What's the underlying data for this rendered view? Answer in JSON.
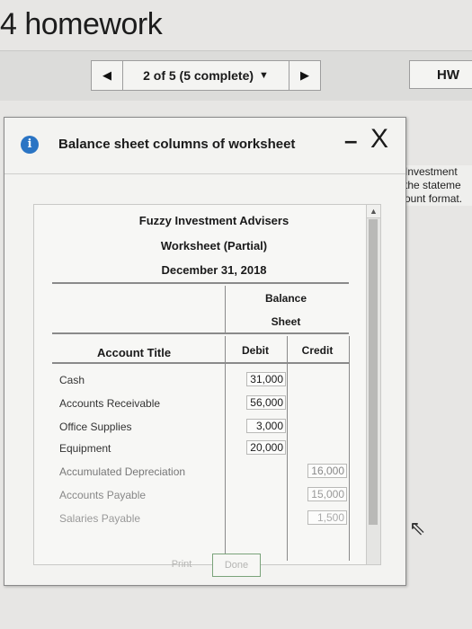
{
  "app": {
    "title": "4 homework"
  },
  "pager": {
    "prev_icon": "◀",
    "status": "2 of 5 (5 complete)",
    "dropdown_icon": "▼",
    "next_icon": "▶"
  },
  "hw_label": "HW",
  "side_text": {
    "line1": "Investment",
    "line2": "the stateme",
    "line3": "ount format."
  },
  "modal": {
    "info_icon": "i",
    "title": "Balance sheet columns of worksheet",
    "minimize_label": "–",
    "close_label": "X"
  },
  "worksheet": {
    "company": "Fuzzy Investment Advisers",
    "subtitle": "Worksheet (Partial)",
    "date": "December 31, 2018",
    "group_header_1": "Balance",
    "group_header_2": "Sheet",
    "col_account": "Account Title",
    "col_debit": "Debit",
    "col_credit": "Credit",
    "rows": [
      {
        "name": "Cash",
        "debit": "31,000",
        "credit": ""
      },
      {
        "name": "Accounts Receivable",
        "debit": "56,000",
        "credit": ""
      },
      {
        "name": "Office Supplies",
        "debit": "3,000",
        "credit": ""
      },
      {
        "name": "Equipment",
        "debit": "20,000",
        "credit": ""
      },
      {
        "name": "Accumulated Depreciation",
        "debit": "",
        "credit": "16,000"
      },
      {
        "name": "Accounts Payable",
        "debit": "",
        "credit": "15,000"
      },
      {
        "name": "Salaries Payable",
        "debit": "",
        "credit": "1,500"
      }
    ]
  },
  "footer": {
    "print_label": "Print",
    "done_label": "Done"
  }
}
